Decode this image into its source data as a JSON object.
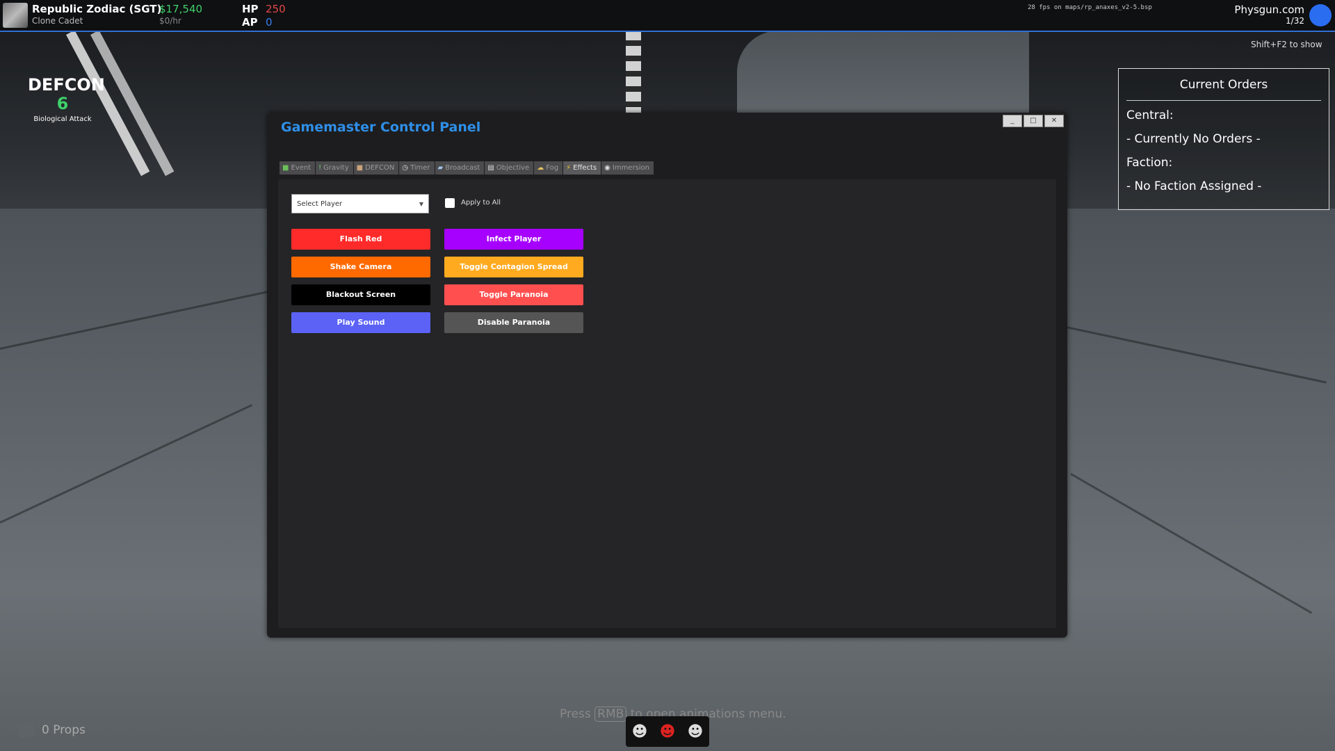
{
  "player": {
    "name": "Republic Zodiac (SGT)",
    "rank": "Clone Cadet",
    "money": "$17,540",
    "salary": "$0/hr",
    "hp_label": "HP",
    "hp_value": "250",
    "ap_label": "AP",
    "ap_value": "0"
  },
  "status": {
    "fps": "28 fps on maps/rp_anaxes_v2-5.bsp",
    "server": "Physgun.com",
    "players": "1/32"
  },
  "hint_shift": "Shift+F2 to show",
  "defcon": {
    "title": "DEFCON",
    "level": "6",
    "subtitle": "Biological Attack"
  },
  "orders": {
    "title": "Current Orders",
    "central_label": "Central:",
    "central_value": "- Currently No Orders -",
    "faction_label": "Faction:",
    "faction_value": "- No Faction Assigned -"
  },
  "panel": {
    "title": "Gamemaster Control Panel",
    "window_buttons": [
      "_",
      "□",
      "✕"
    ],
    "tabs": [
      {
        "label": "Event",
        "icon": "event-icon"
      },
      {
        "label": "Gravity",
        "icon": "gravity-icon"
      },
      {
        "label": "DEFCON",
        "icon": "defcon-icon"
      },
      {
        "label": "Timer",
        "icon": "timer-icon"
      },
      {
        "label": "Broadcast",
        "icon": "broadcast-icon"
      },
      {
        "label": "Objective",
        "icon": "objective-icon"
      },
      {
        "label": "Fog",
        "icon": "fog-icon"
      },
      {
        "label": "Effects",
        "icon": "effects-icon"
      },
      {
        "label": "Immersion",
        "icon": "immersion-icon"
      }
    ],
    "select_player": "Select Player",
    "apply_to_all": "Apply to All",
    "buttons": {
      "flash_red": "Flash Red",
      "shake_camera": "Shake Camera",
      "blackout_screen": "Blackout Screen",
      "play_sound": "Play Sound",
      "infect_player": "Infect Player",
      "toggle_contagion": "Toggle Contagion Spread",
      "toggle_paranoia": "Toggle Paranoia",
      "disable_paranoia": "Disable Paranoia"
    },
    "colors": {
      "flash_red": "#ff2a2a",
      "shake_camera": "#ff6a00",
      "blackout_screen": "#000000",
      "play_sound": "#5b62f5",
      "infect_player": "#a600ff",
      "toggle_contagion": "#ffaa1f",
      "toggle_paranoia": "#ff4f4f",
      "disable_paranoia": "#555555"
    }
  },
  "bottom": {
    "props": "0 Props",
    "anim_press": "Press",
    "anim_key": "RMB",
    "anim_rest": "to open animations menu."
  }
}
